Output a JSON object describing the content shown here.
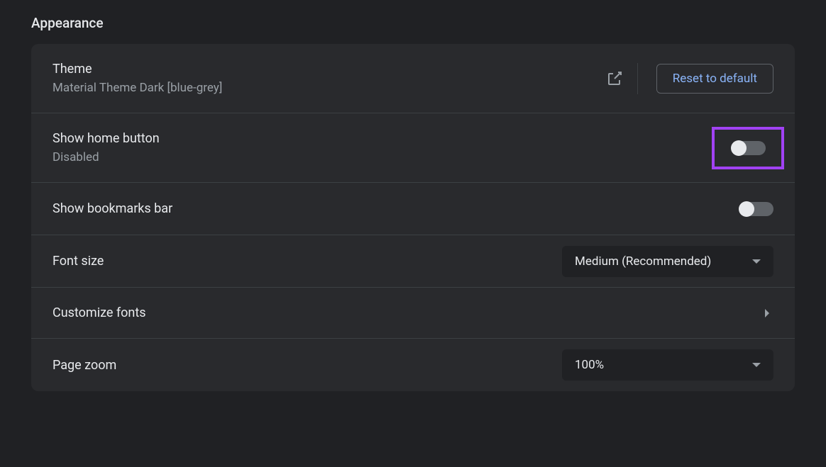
{
  "section_title": "Appearance",
  "theme": {
    "label": "Theme",
    "value": "Material Theme Dark [blue-grey]",
    "reset_label": "Reset to default"
  },
  "home_button": {
    "label": "Show home button",
    "status": "Disabled",
    "enabled": false,
    "highlighted": true
  },
  "bookmarks_bar": {
    "label": "Show bookmarks bar",
    "enabled": false
  },
  "font_size": {
    "label": "Font size",
    "value": "Medium (Recommended)"
  },
  "customize_fonts": {
    "label": "Customize fonts"
  },
  "page_zoom": {
    "label": "Page zoom",
    "value": "100%"
  }
}
